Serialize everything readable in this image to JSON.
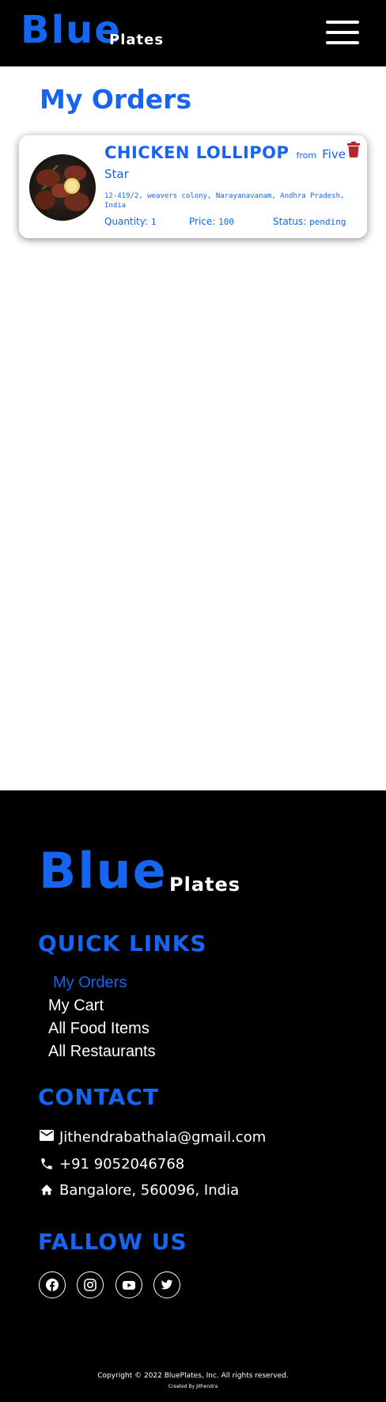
{
  "header": {
    "brand_main": "Blue",
    "brand_sub": "Plates",
    "menu_icon": "hamburger-menu-icon"
  },
  "page": {
    "title": "My Orders"
  },
  "orders": [
    {
      "food_name": "CHICKEN LOLLIPOP",
      "from_label": "from",
      "restaurant_line1": "Five",
      "restaurant_line2": "Star",
      "address": "12-419/2, weavers colony, Narayanavanam, Andhra Pradesh, India",
      "quantity_label": "Quantity:",
      "quantity": "1",
      "price_label": "Price:",
      "price": "100",
      "status_label": "Status:",
      "status": "pending",
      "delete_icon": "trash-icon"
    }
  ],
  "footer": {
    "brand_main": "Blue",
    "brand_sub": "Plates",
    "quick_links_title": "QUICK LINKS",
    "quick_links": [
      "My Orders",
      "My Cart",
      "All Food Items",
      "All Restaurants"
    ],
    "contact_title": "CONTACT",
    "contact": {
      "email": "Jithendrabathala@gmail.com",
      "phone": "+91 9052046768",
      "address": "Bangalore, 560096, India"
    },
    "follow_title": "FALLOW US",
    "socials": [
      "facebook-icon",
      "instagram-icon",
      "youtube-icon",
      "twitter-icon"
    ],
    "copyright": "Copyright © 2022 BluePlates, Inc. All rights reserved.",
    "created_by": "Created By Jithendra"
  },
  "colors": {
    "accent": "#1565f0",
    "header_bg": "#000000",
    "delete": "#b3262d"
  }
}
